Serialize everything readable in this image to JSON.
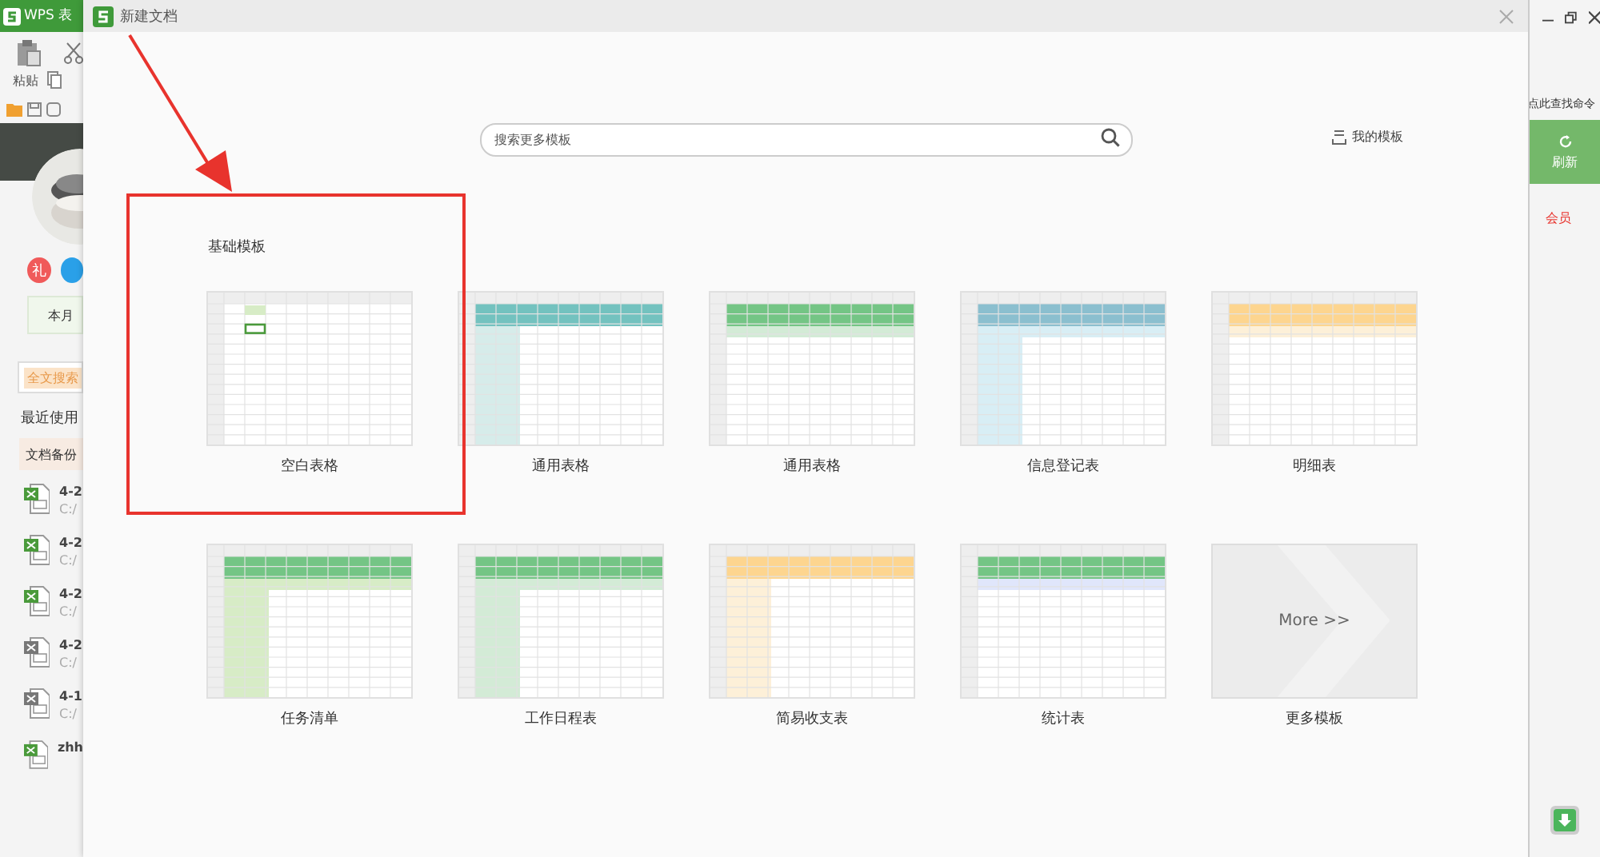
{
  "background_app": {
    "title": "WPS 表",
    "paste_label": "粘贴",
    "gift_badge": "礼",
    "promo": "本月",
    "search_tag": "全文搜索",
    "recent_heading": "最近使用",
    "backup_button": "文档备份",
    "recent_files": [
      {
        "name": "4-2",
        "path": "C:/",
        "color": "#4a9a3b"
      },
      {
        "name": "4-2",
        "path": "C:/",
        "color": "#4a9a3b"
      },
      {
        "name": "4-2",
        "path": "C:/",
        "color": "#4a9a3b"
      },
      {
        "name": "4-2",
        "path": "C:/",
        "color": "#777777"
      },
      {
        "name": "4-1",
        "path": "C:/",
        "color": "#777777"
      },
      {
        "name": "zhh",
        "color": "#4a9a3b"
      }
    ],
    "command_hint": "点此查找命令",
    "refresh_button": "刷新",
    "member_link": "会员"
  },
  "dialog": {
    "title": "新建文档",
    "search": {
      "placeholder": "搜索更多模板"
    },
    "my_templates": "我的模板",
    "section_title": "基础模板",
    "templates": [
      {
        "label": "空白表格",
        "kind": "blank"
      },
      {
        "label": "通用表格",
        "kind": "sheet"
      },
      {
        "label": "通用表格",
        "kind": "sheet"
      },
      {
        "label": "信息登记表",
        "kind": "sheet"
      },
      {
        "label": "明细表",
        "kind": "sheet"
      },
      {
        "label": "任务清单",
        "kind": "sheet"
      },
      {
        "label": "工作日程表",
        "kind": "sheet"
      },
      {
        "label": "简易收支表",
        "kind": "sheet"
      },
      {
        "label": "统计表",
        "kind": "sheet"
      },
      {
        "label": "更多模板",
        "kind": "more",
        "more_label": "More >>"
      }
    ]
  },
  "annotations": {
    "arrow": true,
    "highlight_box": true
  }
}
